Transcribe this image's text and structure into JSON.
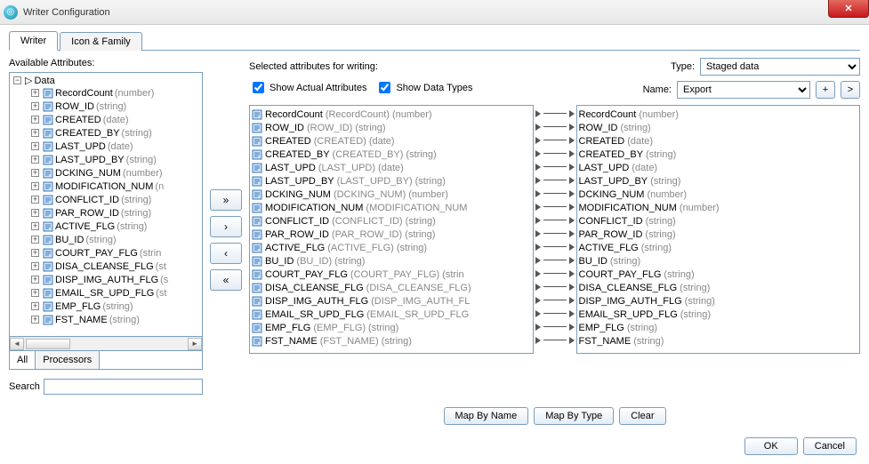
{
  "window": {
    "title": "Writer Configuration"
  },
  "tabs": [
    {
      "label": "Writer"
    },
    {
      "label": "Icon & Family"
    }
  ],
  "available": {
    "label": "Available Attributes:",
    "root": "Data",
    "filter_tabs": {
      "all": "All",
      "processors": "Processors"
    },
    "search_label": "Search",
    "items": [
      {
        "name": "RecordCount",
        "type": "(number)"
      },
      {
        "name": "ROW_ID",
        "type": "(string)"
      },
      {
        "name": "CREATED",
        "type": "(date)"
      },
      {
        "name": "CREATED_BY",
        "type": "(string)"
      },
      {
        "name": "LAST_UPD",
        "type": "(date)"
      },
      {
        "name": "LAST_UPD_BY",
        "type": "(string)"
      },
      {
        "name": "DCKING_NUM",
        "type": "(number)"
      },
      {
        "name": "MODIFICATION_NUM",
        "type": "(n"
      },
      {
        "name": "CONFLICT_ID",
        "type": "(string)"
      },
      {
        "name": "PAR_ROW_ID",
        "type": "(string)"
      },
      {
        "name": "ACTIVE_FLG",
        "type": "(string)"
      },
      {
        "name": "BU_ID",
        "type": "(string)"
      },
      {
        "name": "COURT_PAY_FLG",
        "type": "(strin"
      },
      {
        "name": "DISA_CLEANSE_FLG",
        "type": "(st"
      },
      {
        "name": "DISP_IMG_AUTH_FLG",
        "type": "(s"
      },
      {
        "name": "EMAIL_SR_UPD_FLG",
        "type": "(st"
      },
      {
        "name": "EMP_FLG",
        "type": "(string)"
      },
      {
        "name": "FST_NAME",
        "type": "(string)"
      }
    ]
  },
  "selected": {
    "label": "Selected attributes for writing:",
    "show_actual": "Show Actual Attributes",
    "show_types": "Show Data Types",
    "type_label": "Type:",
    "type_value": "Staged data",
    "name_label": "Name:",
    "name_value": "Export",
    "left": [
      {
        "name": "RecordCount",
        "alias": "(RecordCount)",
        "type": "(number)"
      },
      {
        "name": "ROW_ID",
        "alias": "(ROW_ID)",
        "type": "(string)"
      },
      {
        "name": "CREATED",
        "alias": "(CREATED)",
        "type": "(date)"
      },
      {
        "name": "CREATED_BY",
        "alias": "(CREATED_BY)",
        "type": "(string)"
      },
      {
        "name": "LAST_UPD",
        "alias": "(LAST_UPD)",
        "type": "(date)"
      },
      {
        "name": "LAST_UPD_BY",
        "alias": "(LAST_UPD_BY)",
        "type": "(string)"
      },
      {
        "name": "DCKING_NUM",
        "alias": "(DCKING_NUM)",
        "type": "(number)"
      },
      {
        "name": "MODIFICATION_NUM",
        "alias": "(MODIFICATION_NUM",
        "type": ""
      },
      {
        "name": "CONFLICT_ID",
        "alias": "(CONFLICT_ID)",
        "type": "(string)"
      },
      {
        "name": "PAR_ROW_ID",
        "alias": "(PAR_ROW_ID)",
        "type": "(string)"
      },
      {
        "name": "ACTIVE_FLG",
        "alias": "(ACTIVE_FLG)",
        "type": "(string)"
      },
      {
        "name": "BU_ID",
        "alias": "(BU_ID)",
        "type": "(string)"
      },
      {
        "name": "COURT_PAY_FLG",
        "alias": "(COURT_PAY_FLG)",
        "type": "(strin"
      },
      {
        "name": "DISA_CLEANSE_FLG",
        "alias": "(DISA_CLEANSE_FLG)",
        "type": ""
      },
      {
        "name": "DISP_IMG_AUTH_FLG",
        "alias": "(DISP_IMG_AUTH_FL",
        "type": ""
      },
      {
        "name": "EMAIL_SR_UPD_FLG",
        "alias": "(EMAIL_SR_UPD_FLG",
        "type": ""
      },
      {
        "name": "EMP_FLG",
        "alias": "(EMP_FLG)",
        "type": "(string)"
      },
      {
        "name": "FST_NAME",
        "alias": "(FST_NAME)",
        "type": "(string)"
      }
    ],
    "right": [
      {
        "name": "RecordCount",
        "type": "(number)"
      },
      {
        "name": "ROW_ID",
        "type": "(string)"
      },
      {
        "name": "CREATED",
        "type": "(date)"
      },
      {
        "name": "CREATED_BY",
        "type": "(string)"
      },
      {
        "name": "LAST_UPD",
        "type": "(date)"
      },
      {
        "name": "LAST_UPD_BY",
        "type": "(string)"
      },
      {
        "name": "DCKING_NUM",
        "type": "(number)"
      },
      {
        "name": "MODIFICATION_NUM",
        "type": "(number)"
      },
      {
        "name": "CONFLICT_ID",
        "type": "(string)"
      },
      {
        "name": "PAR_ROW_ID",
        "type": "(string)"
      },
      {
        "name": "ACTIVE_FLG",
        "type": "(string)"
      },
      {
        "name": "BU_ID",
        "type": "(string)"
      },
      {
        "name": "COURT_PAY_FLG",
        "type": "(string)"
      },
      {
        "name": "DISA_CLEANSE_FLG",
        "type": "(string)"
      },
      {
        "name": "DISP_IMG_AUTH_FLG",
        "type": "(string)"
      },
      {
        "name": "EMAIL_SR_UPD_FLG",
        "type": "(string)"
      },
      {
        "name": "EMP_FLG",
        "type": "(string)"
      },
      {
        "name": "FST_NAME",
        "type": "(string)"
      }
    ]
  },
  "buttons": {
    "add_all": "»",
    "add": ">",
    "remove": "‹",
    "remove_all": "«",
    "map_name": "Map By Name",
    "map_type": "Map By Type",
    "clear": "Clear",
    "ok": "OK",
    "cancel": "Cancel",
    "plus": "+",
    "arrow": ">"
  }
}
